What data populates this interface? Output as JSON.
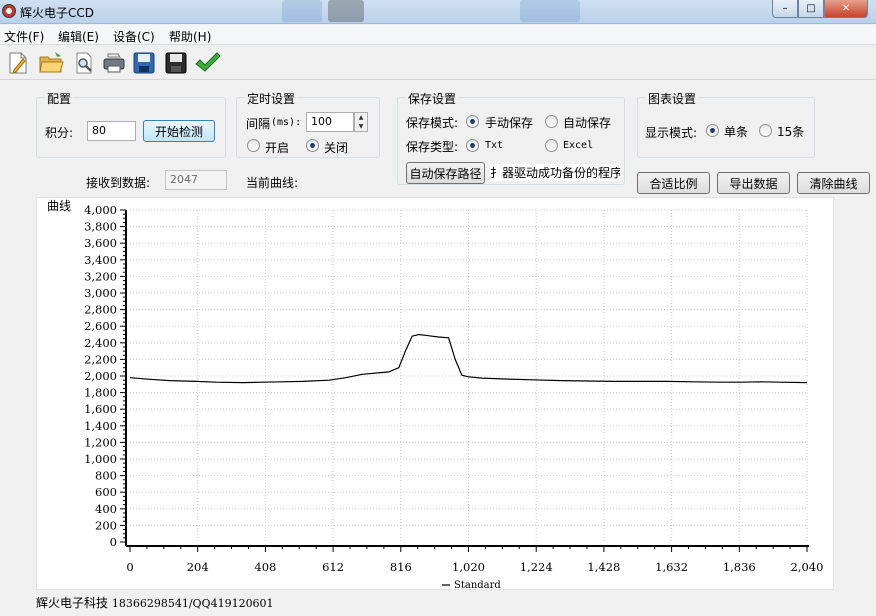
{
  "window": {
    "title": "辉火电子CCD",
    "buttons": [
      "–",
      "□",
      "✕"
    ]
  },
  "menu": [
    {
      "label": "文件(F)"
    },
    {
      "label": "编辑(E)"
    },
    {
      "label": "设备(C)"
    },
    {
      "label": "帮助(H)"
    }
  ],
  "config": {
    "title": "配置",
    "integral_label": "积分:",
    "integral_value": "80",
    "start_button": "开始检测",
    "received_label": "接收到数据:",
    "received_value": "2047"
  },
  "timer": {
    "title": "定时设置",
    "interval_label": "间隔",
    "interval_unit": "(ms):",
    "interval_value": "100",
    "on_label": "开启",
    "off_label": "关闭",
    "selected": "off"
  },
  "save": {
    "title": "保存设置",
    "mode_label": "保存模式:",
    "manual_label": "手动保存",
    "auto_label": "自动保存",
    "mode_selected": "manual",
    "type_label": "保存类型:",
    "txt_label": "Txt",
    "excel_label": "Excel",
    "type_selected": "txt",
    "auto_path_button": "自动保存路径",
    "path_text": "扌器驱动成功备份的程序"
  },
  "chart_settings": {
    "title": "图表设置",
    "display_label": "显示模式:",
    "single_label": "单条",
    "fifteen_label": "15条",
    "selected": "single"
  },
  "current_curve_label": "当前曲线:",
  "actions": {
    "fit_button": "合适比例",
    "export_button": "导出数据",
    "clear_button": "清除曲线"
  },
  "status": {
    "company": "辉火电子科技",
    "contact": "18366298541/QQ419120601"
  },
  "chart_data": {
    "type": "line",
    "title": "曲线",
    "xlabel": "",
    "ylabel": "",
    "xlim": [
      0,
      2040
    ],
    "ylim": [
      0,
      4000
    ],
    "xticks": [
      0,
      204,
      408,
      612,
      816,
      1020,
      1224,
      1428,
      1632,
      1836,
      2040
    ],
    "xtick_labels": [
      "0",
      "204",
      "408",
      "612",
      "816",
      "1,020",
      "1,224",
      "1,428",
      "1,632",
      "1,836",
      "2,040"
    ],
    "yticks": [
      0,
      200,
      400,
      600,
      800,
      1000,
      1200,
      1400,
      1600,
      1800,
      2000,
      2200,
      2400,
      2600,
      2800,
      3000,
      3200,
      3400,
      3600,
      3800,
      4000
    ],
    "ytick_labels": [
      "0",
      "200",
      "400",
      "600",
      "800",
      "1,000",
      "1,200",
      "1,400",
      "1,600",
      "1,800",
      "2,000",
      "2,200",
      "2,400",
      "2,600",
      "2,800",
      "3,000",
      "3,200",
      "3,400",
      "3,600",
      "3,800",
      "4,000"
    ],
    "grid": true,
    "legend": "bottom",
    "series": [
      {
        "name": "Standard",
        "color": "#000000",
        "x": [
          0,
          60,
          120,
          200,
          260,
          340,
          400,
          460,
          520,
          600,
          650,
          700,
          780,
          810,
          830,
          850,
          870,
          890,
          910,
          930,
          960,
          980,
          1000,
          1020,
          1060,
          1120,
          1200,
          1300,
          1380,
          1460,
          1540,
          1620,
          1700,
          1780,
          1840,
          1900,
          1960,
          2040
        ],
        "y": [
          1980,
          1960,
          1945,
          1935,
          1925,
          1920,
          1925,
          1930,
          1935,
          1950,
          1980,
          2020,
          2050,
          2100,
          2300,
          2480,
          2500,
          2490,
          2480,
          2470,
          2460,
          2200,
          2010,
          1990,
          1975,
          1965,
          1955,
          1945,
          1940,
          1935,
          1935,
          1935,
          1930,
          1925,
          1925,
          1930,
          1925,
          1920
        ]
      }
    ]
  }
}
